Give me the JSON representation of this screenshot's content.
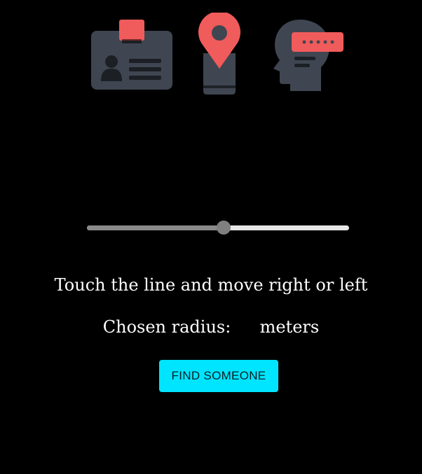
{
  "colors": {
    "background": "#000000",
    "icon_dark": "#3f4651",
    "icon_accent": "#f05b5b",
    "button_bg": "#00e5ff",
    "slider_fill": "#8a8a8a",
    "slider_track": "#e6e6e6",
    "text": "#ffffff"
  },
  "icons": [
    "id-card-icon",
    "location-pin-icon",
    "head-password-icon"
  ],
  "slider": {
    "value_fraction": 0.52
  },
  "instruction": "Touch the line and move right or left",
  "radius": {
    "label": "Chosen radius:",
    "value": "",
    "unit": "meters"
  },
  "actions": {
    "find_label": "FIND SOMEONE"
  }
}
